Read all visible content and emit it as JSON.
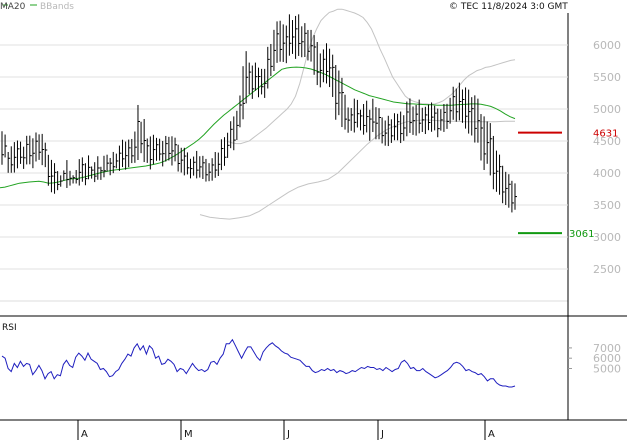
{
  "header": {
    "legend": [
      {
        "label": "MA20",
        "color": "#444444"
      },
      {
        "label": "BBands",
        "color": "#b8b8b8"
      }
    ],
    "copyright": "© TEC 11/8/2024 3:0 GMT"
  },
  "colors": {
    "grid": "#e2e2e2",
    "price_bars": "#000000",
    "ma20": "#22a322",
    "bbands": "#c4c4c4",
    "rsi": "#1f1fbf",
    "resistance": "#cc0000",
    "support": "#119911"
  },
  "chart_data": [
    {
      "type": "ohlc",
      "ylim": [
        2000,
        6500
      ],
      "yticks": [
        6000,
        5500,
        5000,
        4500,
        4000,
        3500,
        3000,
        2500
      ],
      "x_months": [
        "A",
        "M",
        "J",
        "J",
        "A"
      ],
      "series": [
        {
          "name": "Price",
          "high": [
            4652,
            4601,
            4328,
            4417,
            4483,
            4508,
            4490,
            4411,
            4581,
            4584,
            4542,
            4633,
            4604,
            4611,
            4474,
            4284,
            4205,
            4154,
            4030,
            3963,
            4041,
            4202,
            4034,
            3965,
            4047,
            4217,
            4244,
            4153,
            4275,
            4102,
            4169,
            4262,
            4097,
            4269,
            4286,
            4235,
            4329,
            4303,
            4428,
            4520,
            4491,
            4522,
            4532,
            4648,
            5063,
            4801,
            4844,
            4539,
            4571,
            4597,
            4549,
            4536,
            4501,
            4579,
            4565,
            4574,
            4552,
            4442,
            4394,
            4394,
            4322,
            4222,
            4257,
            4345,
            4262,
            4268,
            4220,
            4154,
            4231,
            4328,
            4319,
            4527,
            4560,
            4629,
            4809,
            4884,
            4972,
            5211,
            5669,
            5904,
            5725,
            5679,
            5725,
            5646,
            5627,
            5627,
            5971,
            6016,
            6237,
            6369,
            6379,
            6322,
            6304,
            6479,
            6390,
            6454,
            6479,
            6292,
            6342,
            6235,
            6236,
            6155,
            6047,
            5868,
            5931,
            6027,
            5942,
            5849,
            5687,
            5601,
            5487,
            5223,
            5024,
            5015,
            5162,
            5142,
            4989,
            5078,
            5130,
            4988,
            5160,
            5029,
            5013,
            4869,
            4820,
            4894,
            4839,
            4934,
            4925,
            4960,
            4903,
            5116,
            5165,
            5039,
            5063,
            5147,
            5019,
            5035,
            5070,
            5102,
            5051,
            5006,
            4997,
            5078,
            5081,
            5175,
            5348,
            5320,
            5412,
            5305,
            5337,
            5303,
            5185,
            5213,
            5162,
            4921,
            4885,
            4806,
            4780,
            4579,
            4350,
            4287,
            4113,
            4018,
            3981,
            3878,
            3837
          ],
          "low": [
            4128,
            4243,
            4003,
            4004,
            4007,
            4073,
            4142,
            4064,
            4134,
            4136,
            4075,
            4180,
            4205,
            4123,
            4092,
            3801,
            3699,
            3676,
            3732,
            3786,
            3882,
            3766,
            3803,
            3836,
            3836,
            3804,
            3863,
            3809,
            3902,
            3912,
            3858,
            3895,
            3892,
            3933,
            4022,
            3965,
            3998,
            4073,
            4033,
            4093,
            4052,
            4092,
            4155,
            4159,
            4203,
            4310,
            4171,
            4158,
            4056,
            4135,
            4191,
            4194,
            4103,
            4179,
            4195,
            4117,
            4182,
            4023,
            4008,
            3963,
            3978,
            3916,
            3959,
            3916,
            3929,
            3906,
            3866,
            3872,
            3880,
            3925,
            3953,
            4045,
            4112,
            4236,
            4388,
            4356,
            4516,
            4714,
            4839,
            5088,
            5231,
            5158,
            5286,
            5184,
            5228,
            5173,
            5320,
            5516,
            5594,
            5721,
            5739,
            5735,
            5716,
            5833,
            5861,
            5783,
            5829,
            5809,
            5812,
            5759,
            5741,
            5534,
            5374,
            5338,
            5418,
            5399,
            5343,
            5188,
            4832,
            4904,
            4718,
            4678,
            4629,
            4659,
            4633,
            4711,
            4665,
            4599,
            4634,
            4504,
            4640,
            4527,
            4527,
            4462,
            4427,
            4421,
            4470,
            4512,
            4511,
            4468,
            4504,
            4574,
            4626,
            4595,
            4584,
            4620,
            4641,
            4609,
            4669,
            4644,
            4666,
            4559,
            4662,
            4642,
            4689,
            4771,
            4831,
            4801,
            4822,
            4784,
            4694,
            4616,
            4586,
            4476,
            4474,
            4195,
            4047,
            4144,
            3962,
            3746,
            3706,
            3661,
            3528,
            3500,
            3458,
            3384,
            3426
          ]
        },
        {
          "name": "MA20",
          "values": [
            3770,
            3780,
            3800,
            3820,
            3840,
            3850,
            3860,
            3865,
            3870,
            3860,
            3840,
            3845,
            3860,
            3880,
            3900,
            3910,
            3915,
            3930,
            3950,
            3970,
            3990,
            4010,
            4025,
            4040,
            4050,
            4060,
            4070,
            4080,
            4090,
            4100,
            4110,
            4125,
            4140,
            4160,
            4190,
            4230,
            4270,
            4320,
            4370,
            4420,
            4470,
            4530,
            4600,
            4680,
            4760,
            4830,
            4900,
            4960,
            5020,
            5080,
            5140,
            5200,
            5260,
            5320,
            5380,
            5440,
            5500,
            5560,
            5620,
            5640,
            5650,
            5655,
            5650,
            5640,
            5625,
            5600,
            5570,
            5540,
            5500,
            5460,
            5420,
            5380,
            5340,
            5300,
            5270,
            5240,
            5210,
            5190,
            5170,
            5150,
            5130,
            5110,
            5100,
            5090,
            5080,
            5080,
            5075,
            5070,
            5065,
            5065,
            5060,
            5060,
            5060,
            5060,
            5065,
            5070,
            5075,
            5080,
            5080,
            5075,
            5060,
            5040,
            5010,
            4970,
            4920,
            4880,
            4850
          ]
        },
        {
          "name": "BBands-upper",
          "values": [
            4490,
            4470,
            4460,
            4460,
            4480,
            4500,
            4550,
            4600,
            4650,
            4700,
            4760,
            4820,
            4880,
            4940,
            5000,
            5080,
            5200,
            5400,
            5650,
            5900,
            6100,
            6250,
            6380,
            6450,
            6510,
            6530,
            6560,
            6560,
            6540,
            6520,
            6500,
            6470,
            6430,
            6350,
            6250,
            6100,
            5940,
            5800,
            5650,
            5500,
            5400,
            5300,
            5200,
            5150,
            5120,
            5100,
            5080,
            5080,
            5070,
            5080,
            5100,
            5130,
            5180,
            5230,
            5300,
            5380,
            5460,
            5520,
            5560,
            5600,
            5620,
            5650,
            5660,
            5680,
            5700,
            5720,
            5740,
            5760,
            5770
          ]
        },
        {
          "name": "BBands-lower",
          "values": [
            3350,
            3310,
            3290,
            3280,
            3300,
            3330,
            3400,
            3500,
            3600,
            3700,
            3780,
            3830,
            3860,
            3900,
            4000,
            4150,
            4300,
            4450,
            4580,
            4680,
            4750,
            4800,
            4820,
            4830,
            4820,
            4810,
            4810,
            4800,
            4800,
            4800,
            4800,
            4810,
            4810
          ]
        },
        {
          "name": "RSI",
          "values": [
            62,
            60,
            50,
            47,
            55,
            51,
            57,
            52,
            55,
            54,
            44,
            48,
            53,
            48,
            40,
            45,
            47,
            40,
            44,
            43,
            54,
            58,
            53,
            51,
            61,
            65,
            62,
            58,
            65,
            59,
            57,
            55,
            49,
            50,
            47,
            42,
            43,
            47,
            49,
            55,
            59,
            64,
            62,
            70,
            74,
            68,
            72,
            64,
            72,
            69,
            60,
            62,
            54,
            55,
            59,
            57,
            54,
            47,
            50,
            49,
            45,
            50,
            55,
            51,
            48,
            49,
            47,
            49,
            56,
            57,
            54,
            60,
            64,
            74,
            74,
            78,
            72,
            66,
            60,
            66,
            71,
            71,
            66,
            61,
            58,
            66,
            70,
            73,
            75,
            72,
            70,
            67,
            65,
            64,
            61,
            60,
            59,
            58,
            55,
            52,
            52,
            48,
            46,
            47,
            49,
            48,
            50,
            48,
            49,
            46,
            48,
            47,
            45,
            46,
            48,
            47,
            49,
            51,
            50,
            52,
            51,
            51,
            49,
            50,
            48,
            51,
            49,
            47,
            49,
            50,
            56,
            58,
            55,
            50,
            51,
            48,
            48,
            50,
            47,
            45,
            43,
            41,
            42,
            44,
            46,
            48,
            51,
            55,
            56,
            55,
            52,
            48,
            49,
            47,
            46,
            44,
            45,
            42,
            38,
            40,
            40,
            36,
            34,
            33,
            33,
            32,
            32,
            33
          ]
        }
      ],
      "annotations": [
        {
          "label": "4631",
          "value": 4631,
          "color": "#cc0000"
        },
        {
          "label": "3061",
          "value": 3061,
          "color": "#119911"
        }
      ]
    },
    {
      "type": "line",
      "title": "RSI",
      "ylim": [
        0,
        10000
      ],
      "yticks": [
        7000,
        6000,
        5000
      ],
      "x_months": [
        "A",
        "M",
        "J",
        "J",
        "A"
      ],
      "series": [
        {
          "name": "RSI"
        }
      ]
    }
  ]
}
